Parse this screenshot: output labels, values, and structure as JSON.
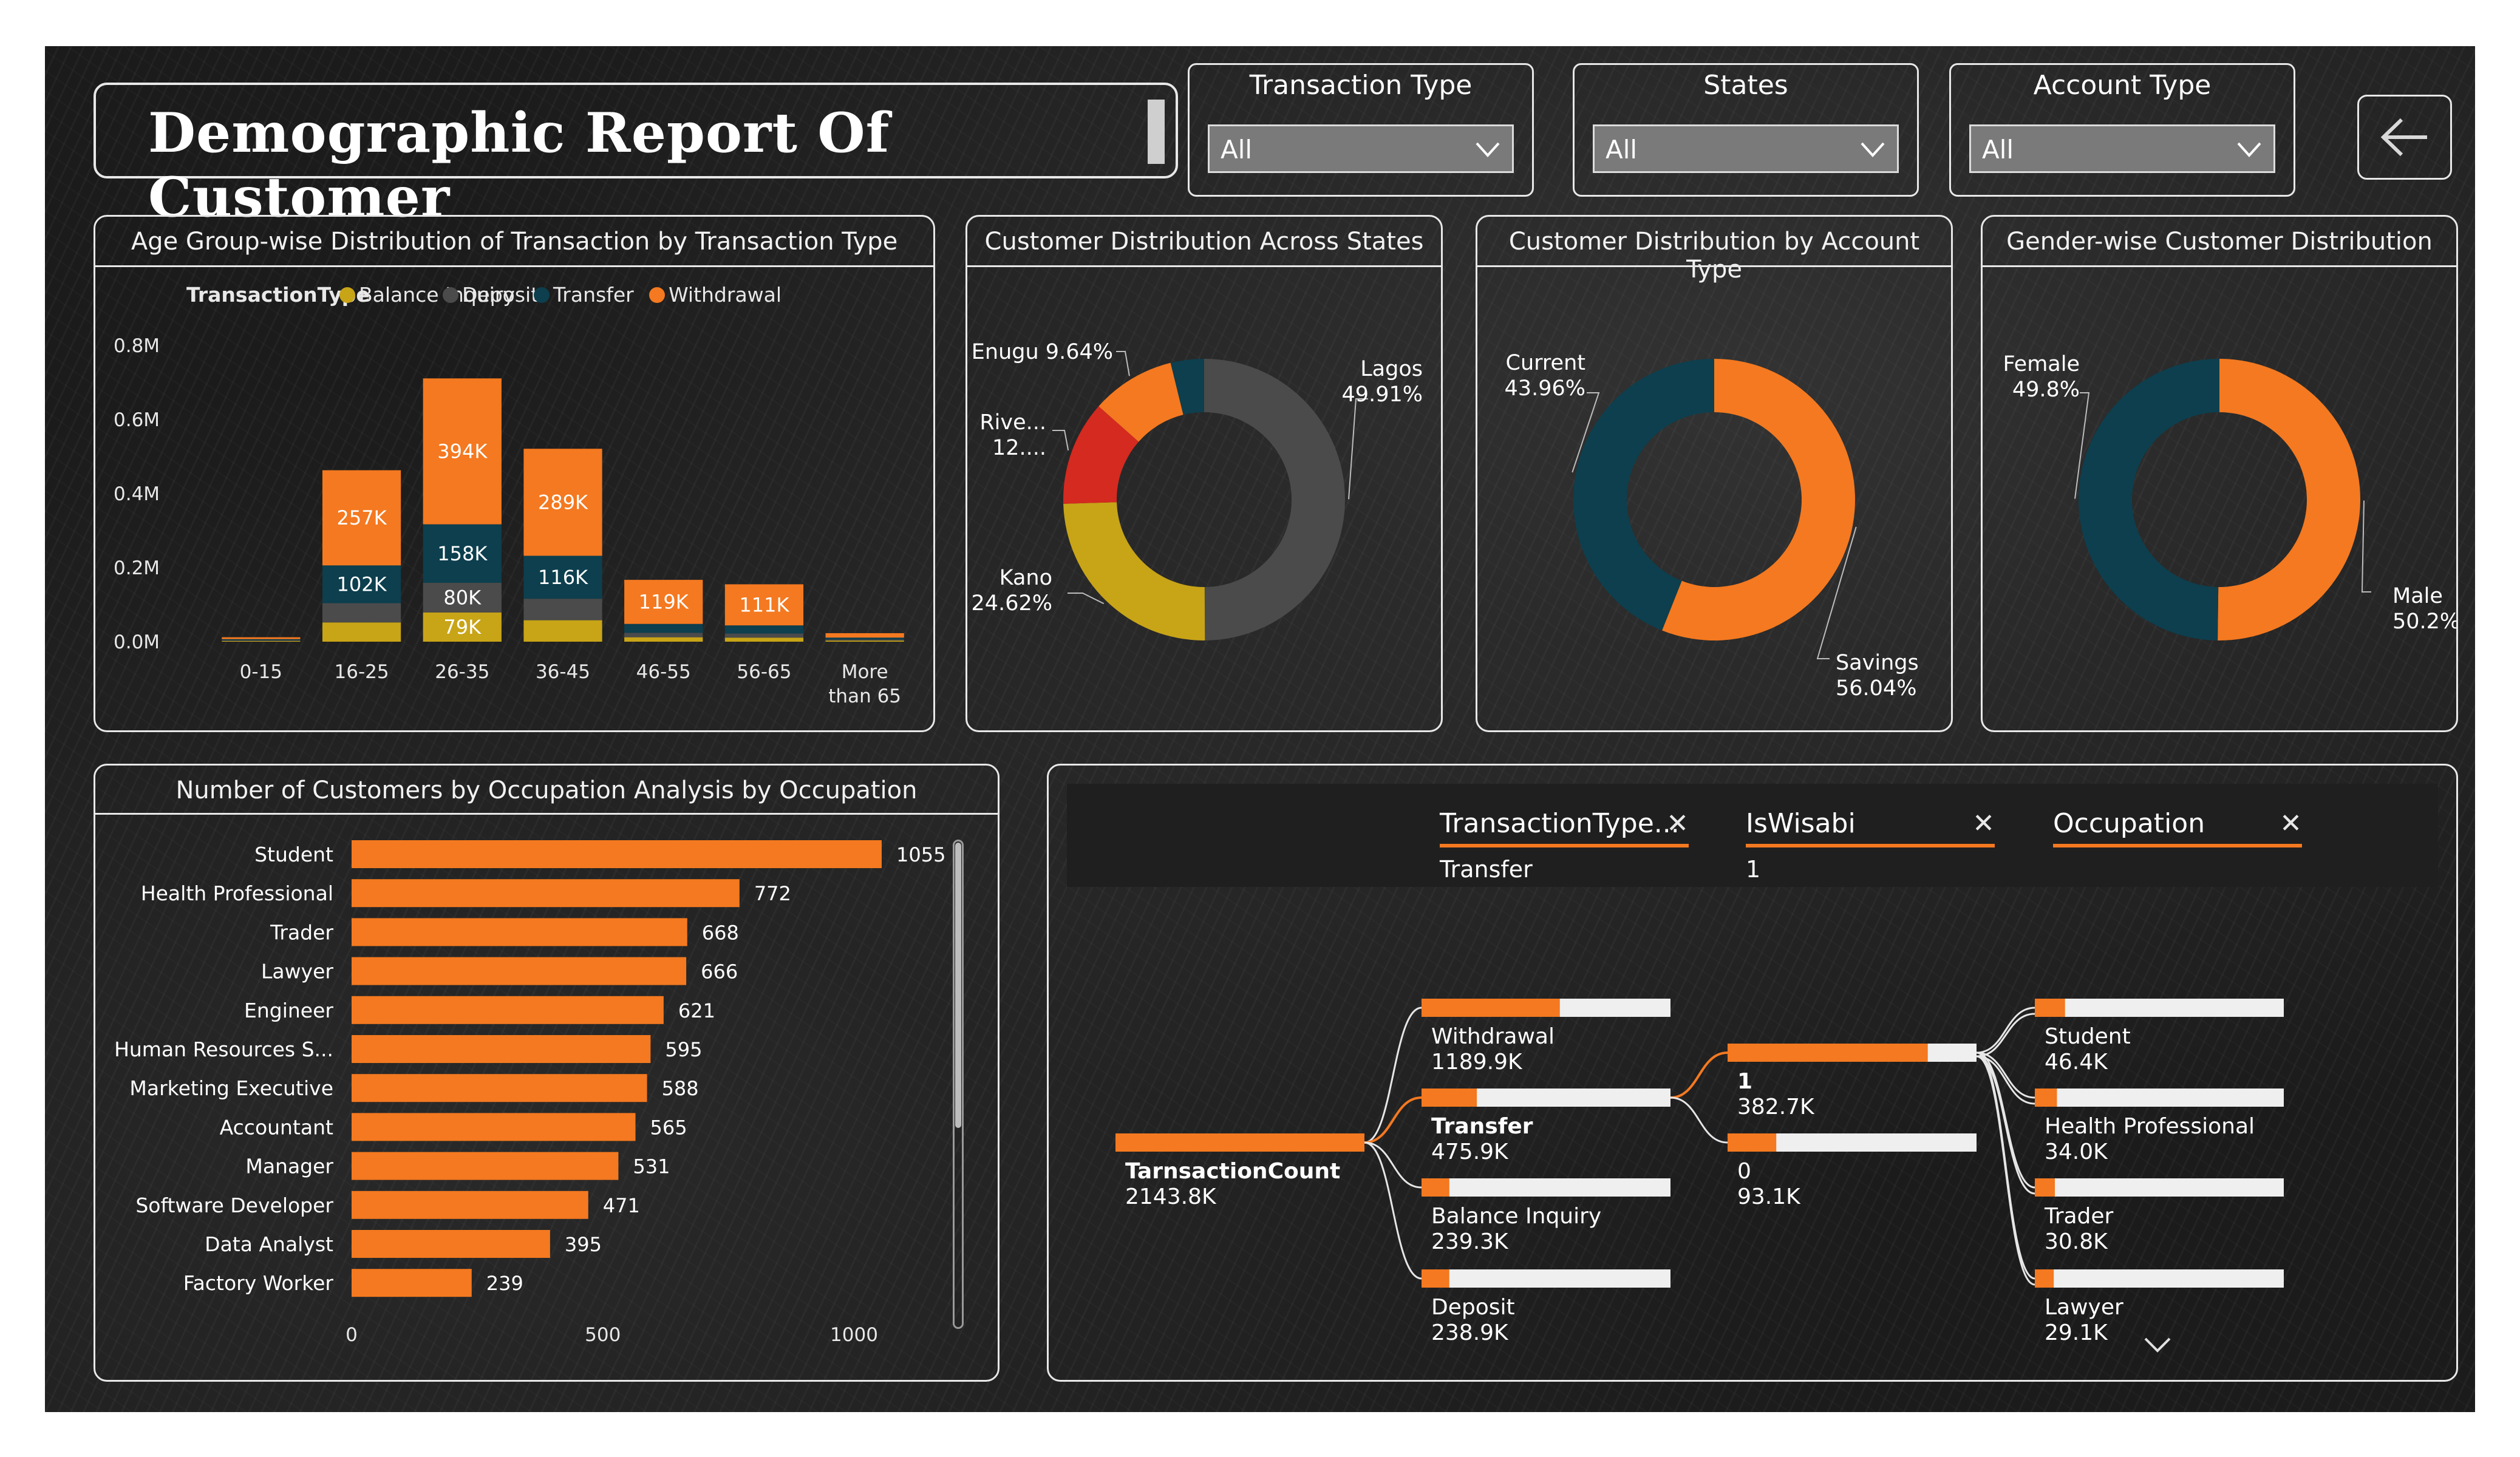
{
  "header": {
    "title": "Demographic Report Of  Customer"
  },
  "filters": [
    {
      "label": "Transaction Type",
      "value": "All"
    },
    {
      "label": "States",
      "value": "All"
    },
    {
      "label": "Account Type",
      "value": "All"
    }
  ],
  "colors": {
    "orange": "#f47920",
    "teal": "#0d3f4e",
    "gray": "#4b4b4b",
    "yellow": "#c8a417",
    "red": "#d42a20"
  },
  "panels": {
    "age": "Age Group-wise Distribution of Transaction by Transaction Type",
    "states": "Customer Distribution Across States",
    "account": "Customer Distribution by Account Type",
    "gender": "Gender-wise Customer Distribution",
    "occupation": "Number of Customers by Occupation Analysis by Occupation"
  },
  "chart_data": [
    {
      "type": "bar",
      "stacked": true,
      "title": "Age Group-wise Distribution of Transaction by Transaction Type",
      "legend_title": "TransactionType",
      "legend_position": "top",
      "categories": [
        "0-15",
        "16-25",
        "26-35",
        "36-45",
        "46-55",
        "56-65",
        "More than 65"
      ],
      "series": [
        {
          "name": "Balance Inquiry",
          "color": "#c8a417",
          "values": [
            0.002,
            0.052,
            0.079,
            0.058,
            0.012,
            0.011,
            0.003
          ],
          "labels": [
            "",
            "",
            "79K",
            "",
            "",
            "",
            ""
          ]
        },
        {
          "name": "Deposit",
          "color": "#4b4b4b",
          "values": [
            0.002,
            0.052,
            0.08,
            0.058,
            0.012,
            0.011,
            0.003
          ],
          "labels": [
            "",
            "",
            "80K",
            "",
            "",
            "",
            ""
          ]
        },
        {
          "name": "Transfer",
          "color": "#0d3f4e",
          "values": [
            0.003,
            0.102,
            0.158,
            0.116,
            0.024,
            0.022,
            0.005
          ],
          "labels": [
            "",
            "102K",
            "158K",
            "116K",
            "",
            "",
            ""
          ]
        },
        {
          "name": "Withdrawal",
          "color": "#f47920",
          "values": [
            0.005,
            0.257,
            0.394,
            0.289,
            0.119,
            0.111,
            0.012
          ],
          "labels": [
            "",
            "257K",
            "394K",
            "289K",
            "119K",
            "111K",
            ""
          ]
        }
      ],
      "yticks": [
        "0.0M",
        "0.2M",
        "0.4M",
        "0.6M",
        "0.8M"
      ],
      "ylim": [
        0,
        0.8
      ]
    },
    {
      "type": "pie",
      "donut": true,
      "title": "Customer Distribution Across States",
      "slices": [
        {
          "label": "Lagos",
          "value": 49.91,
          "text": "49.91%",
          "color": "#4b4b4b"
        },
        {
          "label": "Kano",
          "value": 24.62,
          "text": "24.62%",
          "color": "#c8a417"
        },
        {
          "label": "Rive...",
          "value": 12.0,
          "text": "12....",
          "color": "#d42a20"
        },
        {
          "label": "Enugu",
          "value": 9.64,
          "text": "9.64%",
          "color": "#f47920"
        },
        {
          "label": "",
          "value": 3.83,
          "text": "",
          "color": "#0d3f4e"
        }
      ]
    },
    {
      "type": "pie",
      "donut": true,
      "title": "Customer Distribution by Account Type",
      "slices": [
        {
          "label": "Savings",
          "value": 56.04,
          "text": "56.04%",
          "color": "#f47920"
        },
        {
          "label": "Current",
          "value": 43.96,
          "text": "43.96%",
          "color": "#0d3f4e"
        }
      ]
    },
    {
      "type": "pie",
      "donut": true,
      "title": "Gender-wise Customer Distribution",
      "slices": [
        {
          "label": "Male",
          "value": 50.2,
          "text": "50.2%",
          "color": "#f47920"
        },
        {
          "label": "Female",
          "value": 49.8,
          "text": "49.8%",
          "color": "#0d3f4e"
        }
      ]
    },
    {
      "type": "bar",
      "orientation": "horizontal",
      "title": "Number of Customers by Occupation Analysis by Occupation",
      "categories": [
        "Student",
        "Health Professional",
        "Trader",
        "Lawyer",
        "Engineer",
        "Human Resources S...",
        "Marketing Executive",
        "Accountant",
        "Manager",
        "Software Developer",
        "Data Analyst",
        "Factory Worker"
      ],
      "values": [
        1055,
        772,
        668,
        666,
        621,
        595,
        588,
        565,
        531,
        471,
        395,
        239
      ],
      "xticks": [
        "0",
        "500",
        "1000"
      ],
      "xlim": [
        0,
        1055
      ]
    }
  ],
  "decomp": {
    "fields": [
      {
        "title": "TransactionType...",
        "value": "Transfer"
      },
      {
        "title": "IsWisabi",
        "value": "1"
      },
      {
        "title": "Occupation",
        "value": ""
      }
    ],
    "root": {
      "label": "TarnsactionCount",
      "value": "2143.8K",
      "amount": 2143.8
    },
    "level1": [
      {
        "label": "Withdrawal",
        "value": "1189.9K",
        "amount": 1189.9
      },
      {
        "label": "Transfer",
        "value": "475.9K",
        "amount": 475.9
      },
      {
        "label": "Balance Inquiry",
        "value": "239.3K",
        "amount": 239.3
      },
      {
        "label": "Deposit",
        "value": "238.9K",
        "amount": 238.9
      }
    ],
    "level2": [
      {
        "label": "1",
        "value": "382.7K",
        "amount": 382.7
      },
      {
        "label": "0",
        "value": "93.1K",
        "amount": 93.1
      }
    ],
    "level3": [
      {
        "label": "Student",
        "value": "46.4K",
        "amount": 46.4
      },
      {
        "label": "Health Professional",
        "value": "34.0K",
        "amount": 34.0
      },
      {
        "label": "Trader",
        "value": "30.8K",
        "amount": 30.8
      },
      {
        "label": "Lawyer",
        "value": "29.1K",
        "amount": 29.1
      }
    ]
  }
}
